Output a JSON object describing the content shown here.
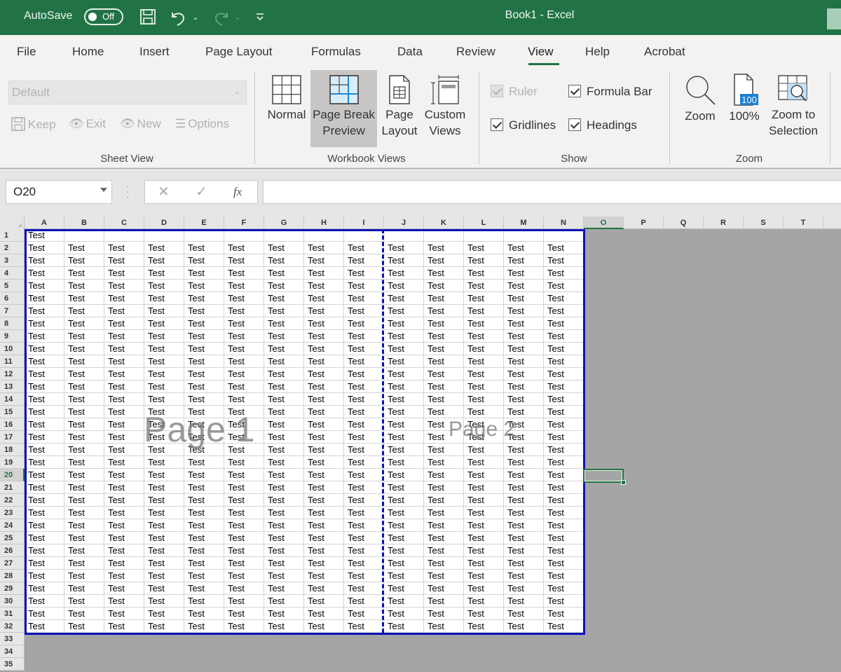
{
  "titlebar": {
    "autosave_label": "AutoSave",
    "autosave_state": "Off",
    "title": "Book1  -  Excel",
    "icons": [
      "save-icon",
      "undo-icon",
      "redo-icon",
      "customize-qat-icon"
    ]
  },
  "tabs": [
    {
      "label": "File",
      "active": false
    },
    {
      "label": "Home",
      "active": false
    },
    {
      "label": "Insert",
      "active": false
    },
    {
      "label": "Page Layout",
      "active": false
    },
    {
      "label": "Formulas",
      "active": false
    },
    {
      "label": "Data",
      "active": false
    },
    {
      "label": "Review",
      "active": false
    },
    {
      "label": "View",
      "active": true
    },
    {
      "label": "Help",
      "active": false
    },
    {
      "label": "Acrobat",
      "active": false
    }
  ],
  "ribbon": {
    "sheet_view": {
      "label": "Sheet View",
      "select_value": "Default",
      "buttons": [
        {
          "label": "Keep",
          "icon": "save-icon"
        },
        {
          "label": "Exit",
          "icon": "eye-exit-icon"
        },
        {
          "label": "New",
          "icon": "eye-new-icon"
        },
        {
          "label": "Options",
          "icon": "list-icon"
        }
      ]
    },
    "workbook_views": {
      "label": "Workbook Views",
      "buttons": [
        {
          "line1": "Normal",
          "line2": "",
          "active": false
        },
        {
          "line1": "Page Break",
          "line2": "Preview",
          "active": true
        },
        {
          "line1": "Page",
          "line2": "Layout",
          "active": false
        },
        {
          "line1": "Custom",
          "line2": "Views",
          "active": false
        }
      ]
    },
    "show": {
      "label": "Show",
      "checkboxes": [
        {
          "label": "Ruler",
          "checked": true,
          "disabled": true
        },
        {
          "label": "Formula Bar",
          "checked": true,
          "disabled": false
        },
        {
          "label": "Gridlines",
          "checked": true,
          "disabled": false
        },
        {
          "label": "Headings",
          "checked": true,
          "disabled": false
        }
      ]
    },
    "zoom": {
      "label": "Zoom",
      "buttons": [
        {
          "line1": "Zoom",
          "line2": ""
        },
        {
          "line1": "100%",
          "line2": "",
          "badge": "100"
        },
        {
          "line1": "Zoom to",
          "line2": "Selection"
        }
      ]
    }
  },
  "formula_bar": {
    "name_box": "O20",
    "cancel": "✕",
    "enter": "✓",
    "fx": "fx",
    "value": ""
  },
  "sheet": {
    "columns": [
      "A",
      "B",
      "C",
      "D",
      "E",
      "F",
      "G",
      "H",
      "I",
      "J",
      "K",
      "L",
      "M",
      "N",
      "O",
      "P",
      "Q",
      "R",
      "S",
      "T"
    ],
    "selected_column": "O",
    "rows": [
      "1",
      "2",
      "3",
      "4",
      "5",
      "6",
      "7",
      "8",
      "9",
      "10",
      "11",
      "12",
      "13",
      "14",
      "15",
      "16",
      "17",
      "18",
      "19",
      "20",
      "21",
      "22",
      "23",
      "24",
      "25",
      "26",
      "27",
      "28",
      "29",
      "30",
      "31",
      "32",
      "33",
      "34",
      "35"
    ],
    "selected_row": "20",
    "active_cell": "O20",
    "cell_text": "Test",
    "row1_filled_columns": [
      "A"
    ],
    "filled_rows": "1-32",
    "filled_columns": "A-N",
    "page_labels": [
      "Page 1",
      "Page 2"
    ],
    "page_break_after_column": "I"
  }
}
